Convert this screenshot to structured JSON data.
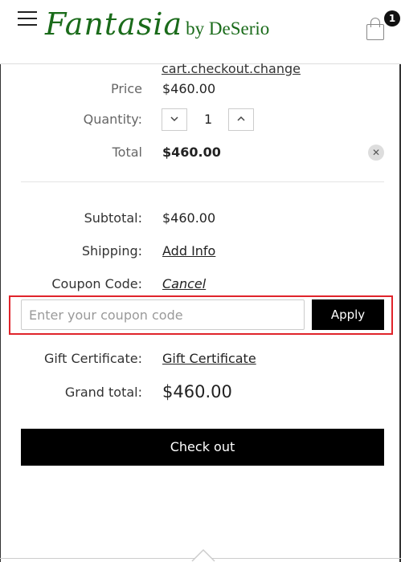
{
  "header": {
    "logo_script": "Fantasia",
    "logo_by": "by DeSerio",
    "cart_count": "1",
    "menu_icon": "hamburger-icon",
    "cart_icon": "shopping-bag-icon"
  },
  "item": {
    "change_link": "cart.checkout.change",
    "price_label": "Price",
    "price_value": "$460.00",
    "quantity_label": "Quantity:",
    "quantity_value": "1",
    "decrease_icon": "chevron-down-icon",
    "increase_icon": "chevron-up-icon",
    "total_label": "Total",
    "total_value": "$460.00",
    "remove_icon": "close-icon"
  },
  "summary": {
    "subtotal_label": "Subtotal:",
    "subtotal_value": "$460.00",
    "shipping_label": "Shipping:",
    "shipping_link": "Add Info",
    "coupon_label": "Coupon Code:",
    "coupon_cancel": "Cancel",
    "coupon_placeholder": "Enter your coupon code",
    "apply_label": "Apply",
    "gift_label": "Gift Certificate:",
    "gift_link": "Gift Certificate",
    "grand_label": "Grand total:",
    "grand_value": "$460.00",
    "checkout_label": "Check out"
  },
  "colors": {
    "logo_green": "#1a6b1a",
    "highlight_red": "#e0242b",
    "button_black": "#000000"
  }
}
